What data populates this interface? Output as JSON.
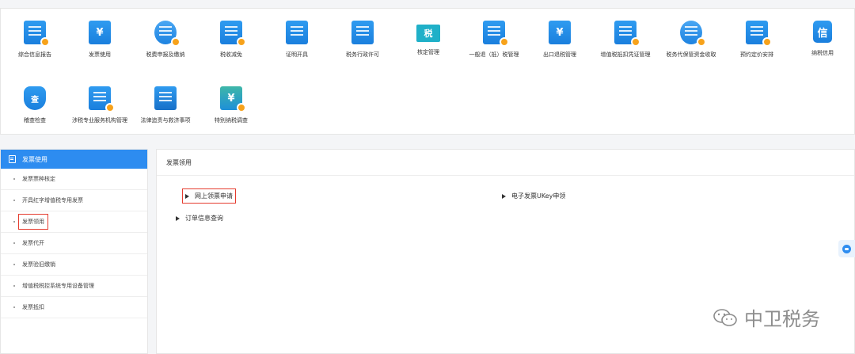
{
  "top_menu": {
    "row1": [
      {
        "label": "综合信息报告",
        "icon": "report-icon"
      },
      {
        "label": "发票使用",
        "icon": "invoice-icon",
        "glyph": "¥"
      },
      {
        "label": "税费申报及缴纳",
        "icon": "tax-declare-icon"
      },
      {
        "label": "税收减免",
        "icon": "tax-reduction-icon"
      },
      {
        "label": "证明开具",
        "icon": "certificate-icon"
      },
      {
        "label": "税务行政许可",
        "icon": "permit-icon"
      },
      {
        "label": "核定管理",
        "icon": "assessment-icon",
        "glyph": "税"
      },
      {
        "label": "一般退（抵）税管理",
        "icon": "refund-icon"
      },
      {
        "label": "出口退税管理",
        "icon": "export-refund-icon",
        "glyph": "¥"
      },
      {
        "label": "增值税抵扣凭证管理",
        "icon": "vat-deduction-icon"
      },
      {
        "label": "税务代保管资金收取",
        "icon": "custody-fund-icon"
      },
      {
        "label": "预约定价安排",
        "icon": "pricing-icon"
      },
      {
        "label": "纳税信用",
        "icon": "credit-icon",
        "glyph": "信"
      }
    ],
    "row2": [
      {
        "label": "稽查检查",
        "icon": "inspection-icon",
        "glyph": "查"
      },
      {
        "label": "涉税专业服务机构管理",
        "icon": "service-agency-icon"
      },
      {
        "label": "法律追责与救济事项",
        "icon": "legal-icon"
      },
      {
        "label": "特别纳税调查",
        "icon": "special-investigation-icon",
        "glyph": "¥"
      }
    ]
  },
  "sidebar": {
    "header": "发票使用",
    "items": [
      {
        "label": "发票票种核定"
      },
      {
        "label": "开具红字增值税专用发票"
      },
      {
        "label": "发票领用"
      },
      {
        "label": "发票代开"
      },
      {
        "label": "发票验旧缴销"
      },
      {
        "label": "增值税税控系统专用设备管理"
      },
      {
        "label": "发票抵扣"
      }
    ]
  },
  "content": {
    "title": "发票领用",
    "links": {
      "online_apply": "网上领票申请",
      "ukey_apply": "电子发票UKey申领",
      "order_query": "订单信息查询"
    }
  },
  "watermark": {
    "text": "中卫税务"
  },
  "colors": {
    "accent": "#2d8cf0",
    "highlight_box": "#e53c2f"
  }
}
